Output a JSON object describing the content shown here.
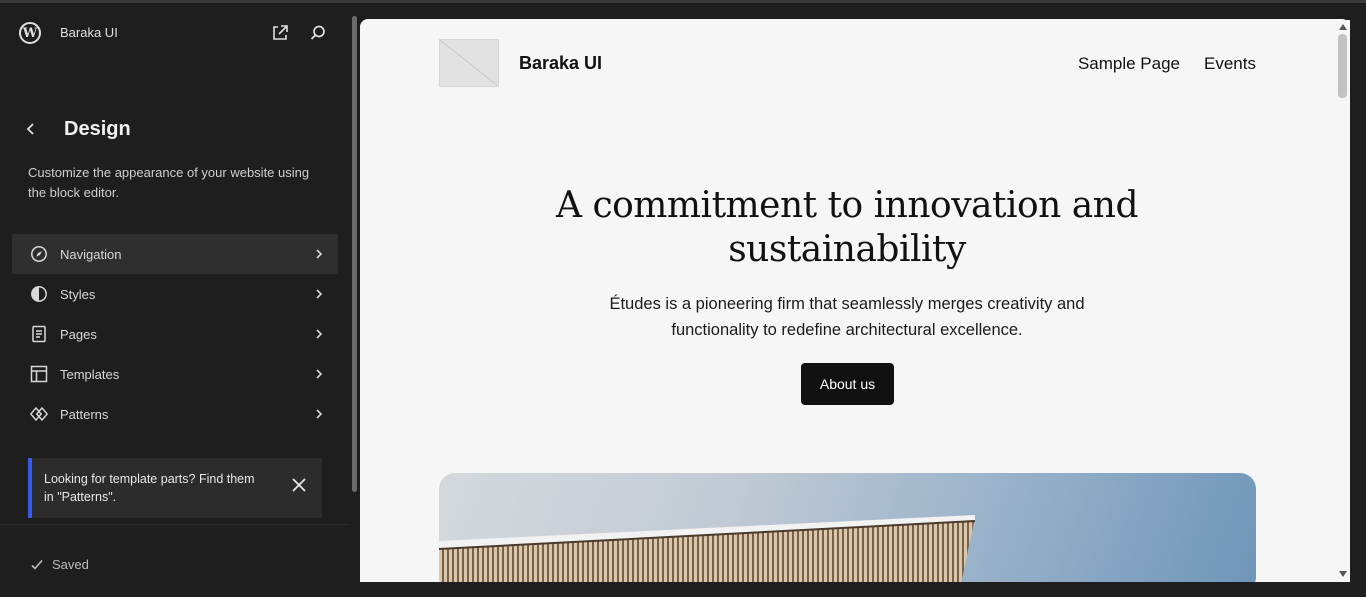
{
  "colors": {
    "accent": "#3858e9",
    "sidebar_bg": "#1e1e1e",
    "preview_bg": "#f6f6f6",
    "button_bg": "#111111"
  },
  "header": {
    "site_name": "Baraka UI",
    "icons": [
      "wordpress-icon",
      "external-link-icon",
      "search-icon"
    ]
  },
  "design": {
    "title": "Design",
    "description": "Customize the appearance of your website using the block editor."
  },
  "nav": {
    "items": [
      {
        "label": "Navigation",
        "icon": "navigation-icon",
        "active": true
      },
      {
        "label": "Styles",
        "icon": "styles-icon"
      },
      {
        "label": "Pages",
        "icon": "pages-icon"
      },
      {
        "label": "Templates",
        "icon": "templates-icon"
      },
      {
        "label": "Patterns",
        "icon": "patterns-icon"
      }
    ]
  },
  "notice": {
    "text": "Looking for template parts? Find them in \"Patterns\"."
  },
  "footer": {
    "status": "Saved"
  },
  "preview": {
    "site_title": "Baraka UI",
    "menu": [
      "Sample Page",
      "Events"
    ],
    "hero_title": "A commitment to innovation and sustainability",
    "hero_text": "Études is a pioneering firm that seamlessly merges creativity and functionality to redefine architectural excellence.",
    "button_label": "About us"
  }
}
